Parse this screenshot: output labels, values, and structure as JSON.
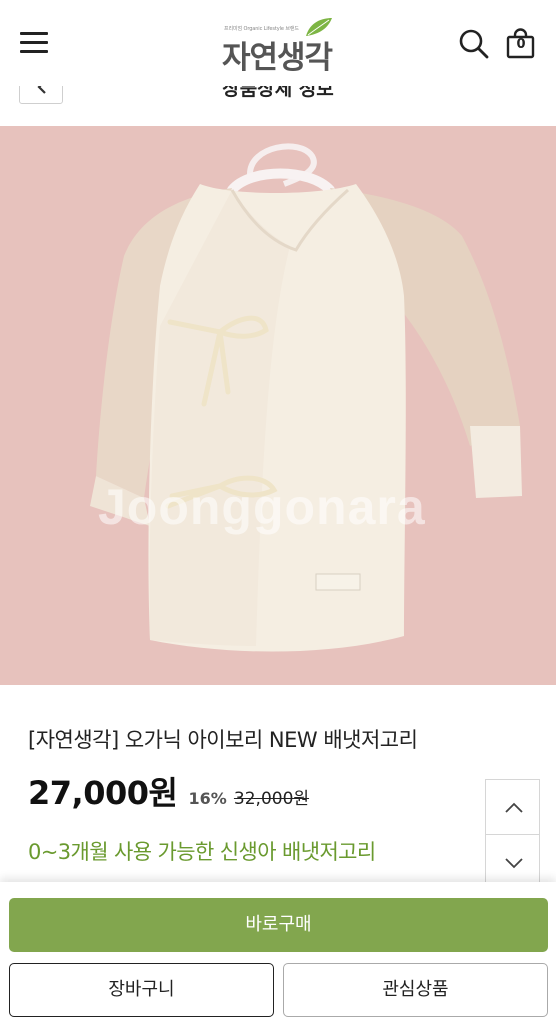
{
  "header": {
    "logo_tagline": "프리미엄 Organic Lifestyle 브랜드",
    "logo_text": "자연생각",
    "cart_count": "0"
  },
  "subbar": {
    "title": "상품상세 정보"
  },
  "product": {
    "image_watermark": "Joonggonara",
    "name": "[자연생각] 오가닉 아이보리 NEW 배냇저고리",
    "price": "27,000원",
    "discount": "16%",
    "original_price": "32,000원",
    "description": "0~3개월 사용 가능한 신생아 배냇저고리"
  },
  "actions": {
    "buy_now": "바로구매",
    "add_to_cart": "장바구니",
    "wishlist": "관심상품"
  },
  "colors": {
    "accent_green": "#82a64e",
    "desc_green": "#6a9a2f",
    "image_bg": "#e7c2bd"
  },
  "icons": [
    "menu-icon",
    "search-icon",
    "cart-icon",
    "chevron-left-icon",
    "chevron-up-icon",
    "chevron-down-icon"
  ]
}
